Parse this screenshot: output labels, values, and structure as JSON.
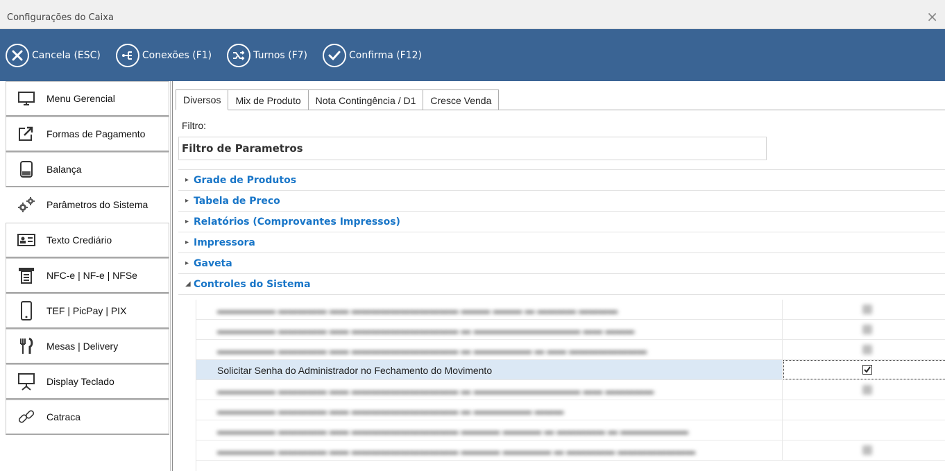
{
  "window": {
    "title": "Configurações do Caixa",
    "close_glyph": "×"
  },
  "toolbar": {
    "buttons": [
      {
        "label": "Cancela (ESC)",
        "icon": "cancel-icon"
      },
      {
        "label": "Conexões (F1)",
        "icon": "connections-icon"
      },
      {
        "label": "Turnos (F7)",
        "icon": "shuffle-icon"
      },
      {
        "label": "Confirma (F12)",
        "icon": "confirm-check-icon"
      }
    ]
  },
  "sidebar": {
    "items": [
      {
        "label": "Menu Gerencial",
        "icon": "monitor-icon"
      },
      {
        "label": "Formas de Pagamento",
        "icon": "external-link-icon"
      },
      {
        "label": "Balança",
        "icon": "scale-icon"
      },
      {
        "label": "Parâmetros do Sistema",
        "icon": "gears-icon"
      },
      {
        "label": "Texto Crediário",
        "icon": "id-card-icon"
      },
      {
        "label": "NFC-e | NF-e | NFSe",
        "icon": "receipt-printer-icon"
      },
      {
        "label": "TEF | PicPay | PIX",
        "icon": "smartphone-icon"
      },
      {
        "label": "Mesas | Delivery",
        "icon": "cutlery-icon"
      },
      {
        "label": "Display Teclado",
        "icon": "display-stand-icon"
      },
      {
        "label": "Catraca",
        "icon": "chain-link-icon"
      }
    ],
    "active_index": 3
  },
  "tabs": [
    "Diversos",
    "Mix de Produto",
    "Nota Contingência / D1",
    "Cresce Venda"
  ],
  "filter": {
    "label": "Filtro:",
    "value": "Filtro de Parametros"
  },
  "groups": [
    {
      "title": "Grade de Produtos",
      "expanded": false
    },
    {
      "title": "Tabela de Preco",
      "expanded": false
    },
    {
      "title": "Relatórios (Comprovantes Impressos)",
      "expanded": false
    },
    {
      "title": "Impressora",
      "expanded": false
    },
    {
      "title": "Gaveta",
      "expanded": false
    },
    {
      "title": "Controles do Sistema",
      "expanded": true
    }
  ],
  "grid": {
    "visible_row": {
      "label": "Solicitar Senha do Administrador no Fechamento do Movimento",
      "checked": true
    }
  },
  "colors": {
    "toolbar_bg": "#3a6494",
    "group_title": "#1976c8",
    "selected_row": "#dbe8f5"
  }
}
